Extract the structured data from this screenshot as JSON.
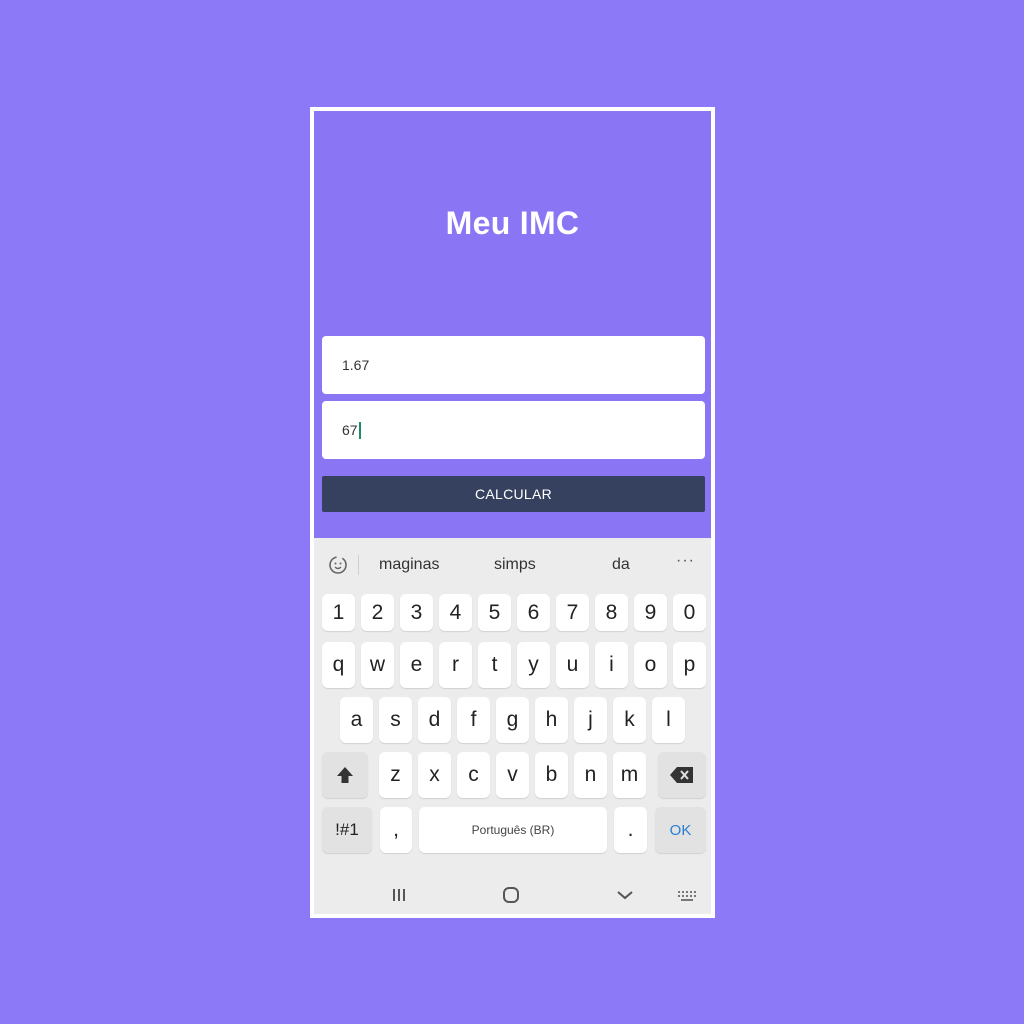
{
  "app": {
    "title": "Meu IMC",
    "height_value": "1.67",
    "weight_value": "67",
    "calculate_label": "CALCULAR"
  },
  "keyboard": {
    "suggestions": [
      "maginas",
      "simps",
      "da"
    ],
    "more": "···",
    "number_row": [
      "1",
      "2",
      "3",
      "4",
      "5",
      "6",
      "7",
      "8",
      "9",
      "0"
    ],
    "row1": [
      "q",
      "w",
      "e",
      "r",
      "t",
      "y",
      "u",
      "i",
      "o",
      "p"
    ],
    "row2": [
      "a",
      "s",
      "d",
      "f",
      "g",
      "h",
      "j",
      "k",
      "l"
    ],
    "row3": [
      "z",
      "x",
      "c",
      "v",
      "b",
      "n",
      "m"
    ],
    "symbols_label": "!#1",
    "comma_label": ",",
    "space_label": "Português (BR)",
    "period_label": ".",
    "ok_label": "OK"
  },
  "icons": {
    "recents": "recents-icon",
    "home": "home-icon",
    "back": "back-chevron-icon",
    "keyboard": "keyboard-icon"
  },
  "colors": {
    "background": "#8c79f8",
    "app_background": "#8a76f4",
    "button": "#35415f",
    "cursor": "#1e8a6e",
    "ok_text": "#2a7fd4"
  }
}
